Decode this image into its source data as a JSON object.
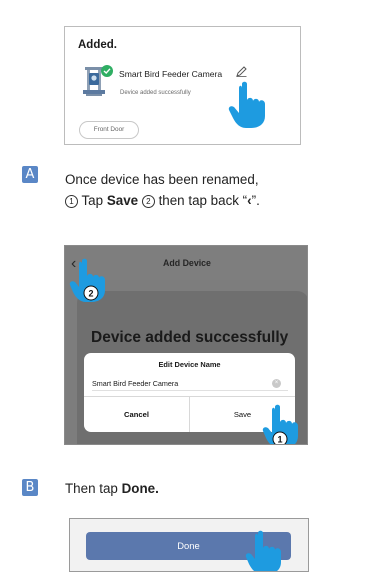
{
  "colors": {
    "accent": "#5a87c6",
    "done_button": "#5b78ad",
    "hand": "#1e9be0",
    "check": "#2fae63"
  },
  "panel1": {
    "title": "Added.",
    "device_name": "Smart Bird Feeder Camera",
    "device_status": "Device added successfully",
    "room_chip": "Front Door"
  },
  "stepA": {
    "badge": "A",
    "line1": "Once device has been renamed,",
    "num1": "1",
    "tap": "Tap",
    "save_word": "Save",
    "num2": "2",
    "then_tap_back": "then tap back “",
    "back_glyph": "‹",
    "close_quote": "”."
  },
  "panel2": {
    "nav_title": "Add Device",
    "heading": "Device added successfully",
    "dialog_title": "Edit Device Name",
    "field_value": "Smart Bird Feeder Camera",
    "cancel_label": "Cancel",
    "save_label": "Save",
    "marker_back": "2",
    "marker_save": "1"
  },
  "stepB": {
    "badge": "B",
    "text_prefix": "Then tap",
    "text_bold": "Done."
  },
  "panel3": {
    "done_label": "Done"
  }
}
